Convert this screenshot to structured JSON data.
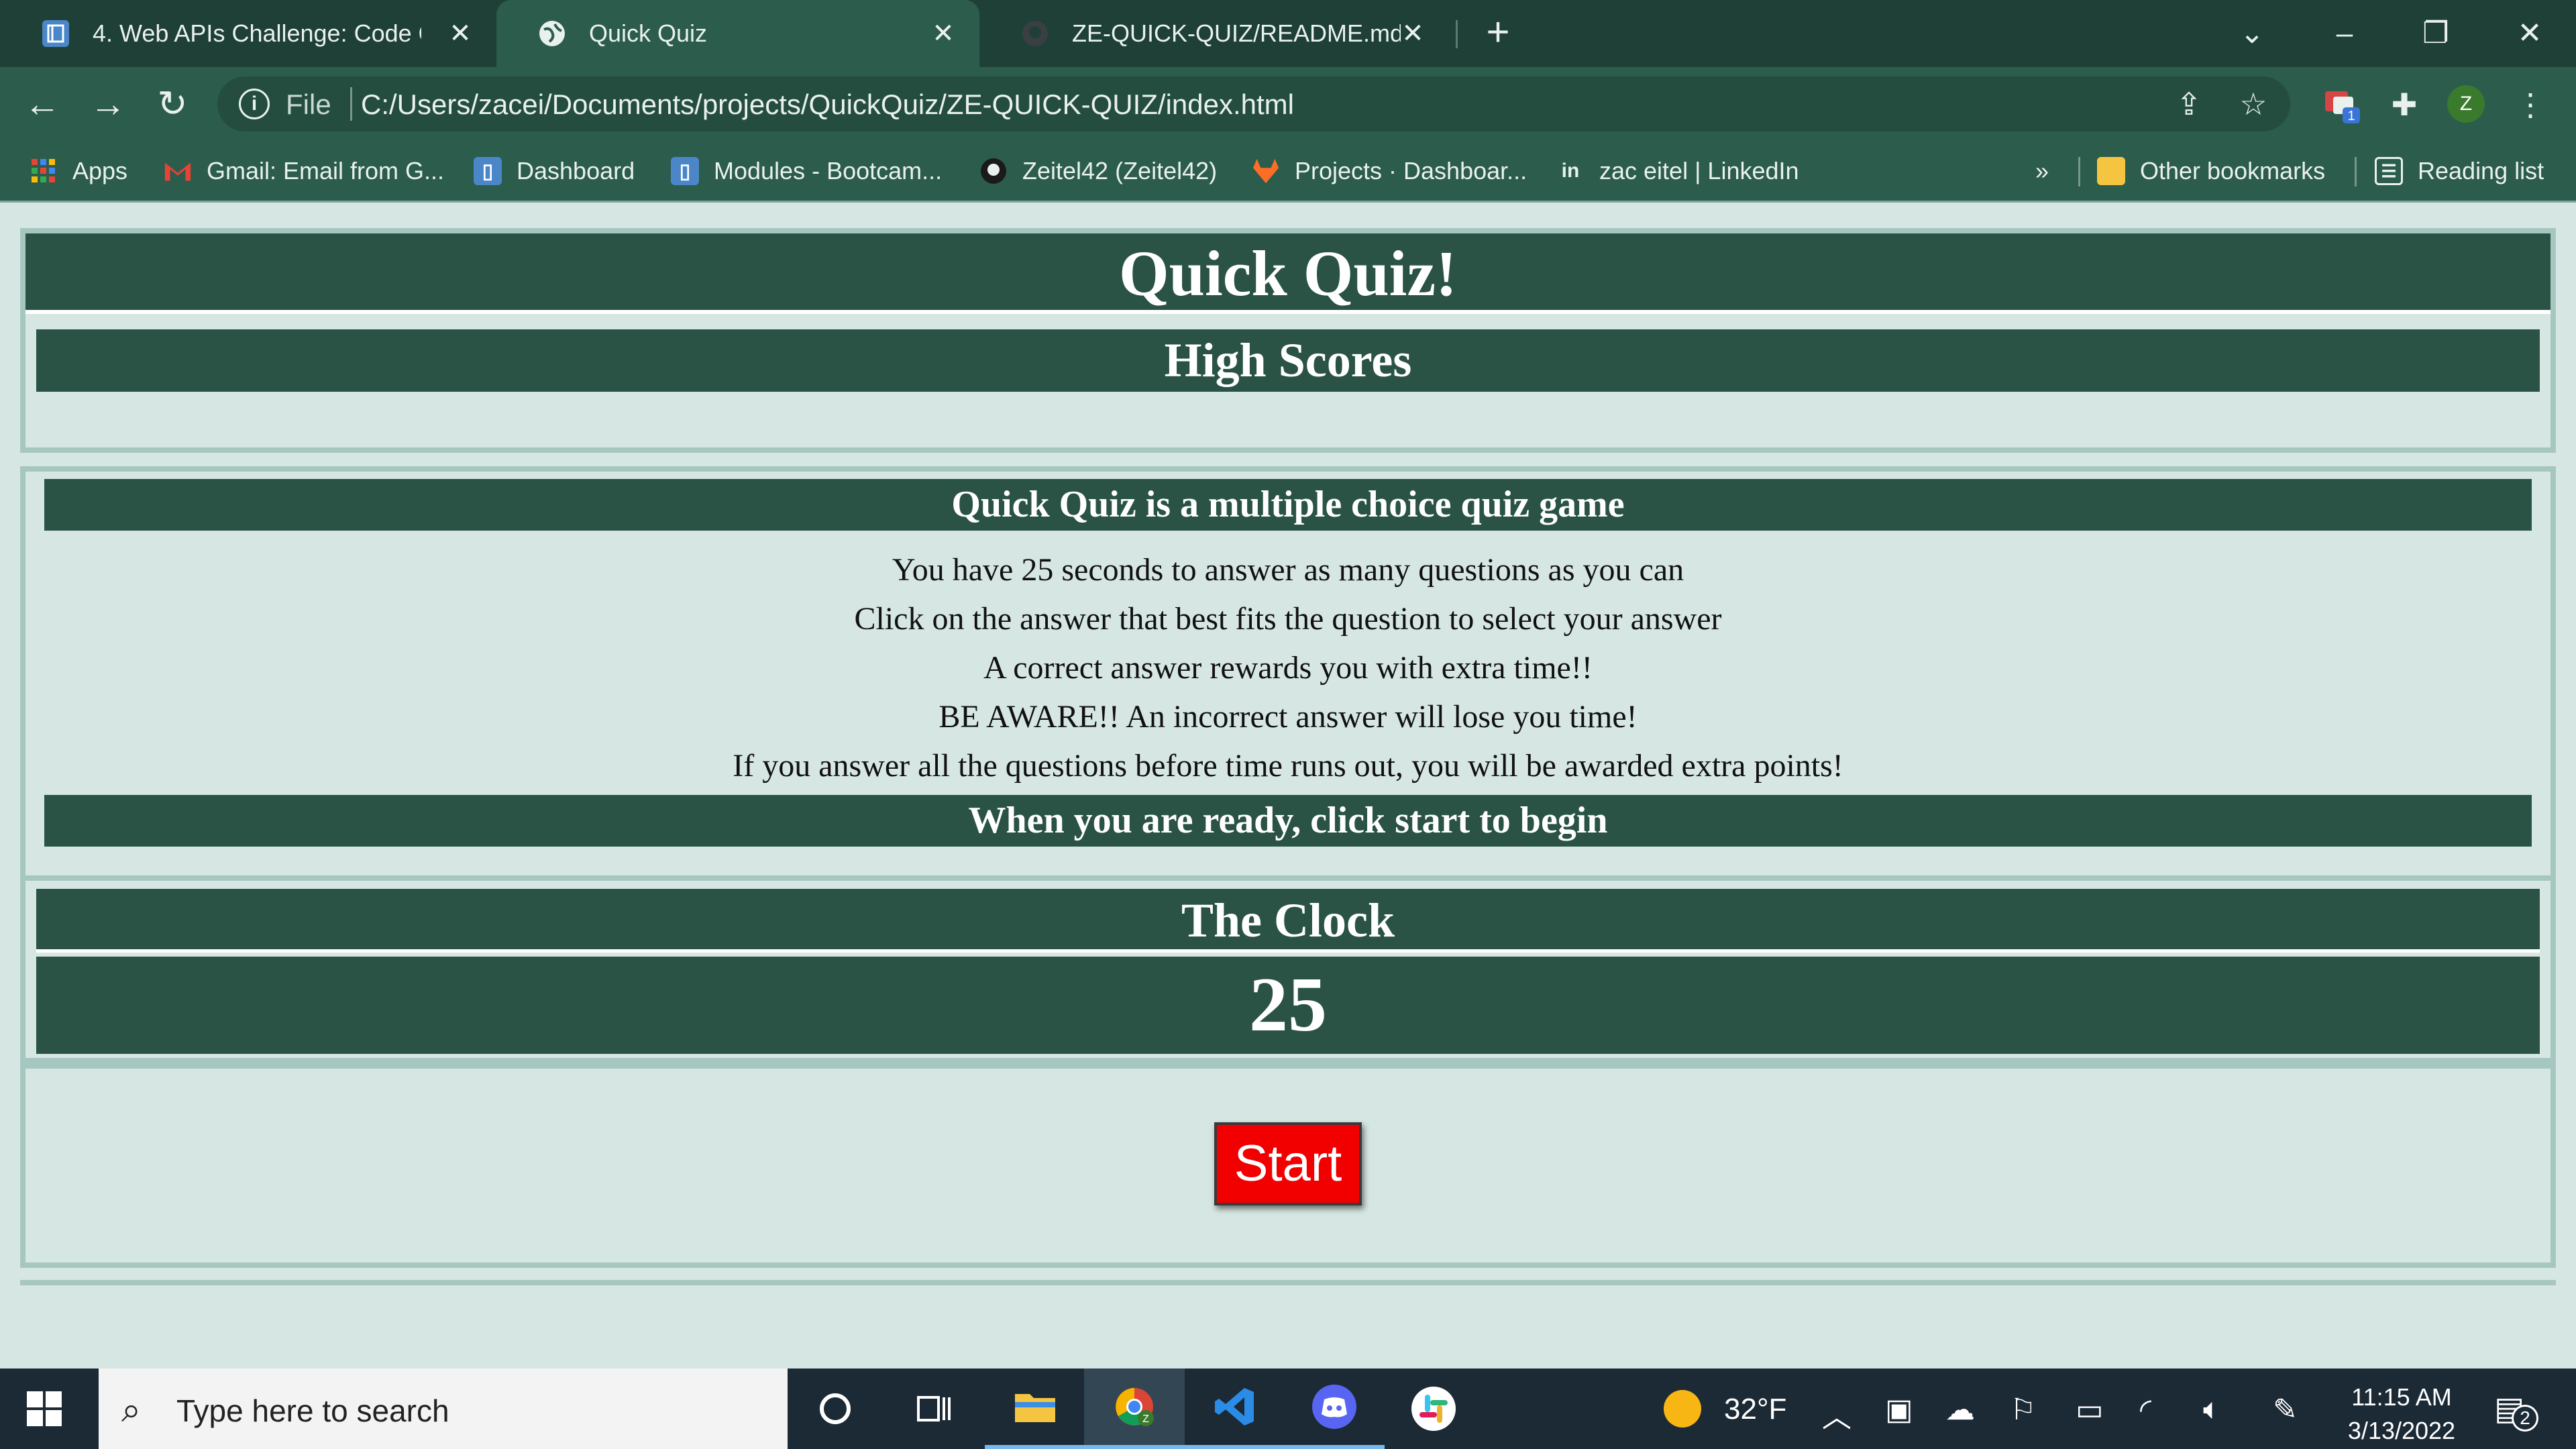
{
  "browser": {
    "tabs": [
      {
        "title": "4. Web APIs Challenge: Code Qui",
        "icon": "bootcamp-icon"
      },
      {
        "title": "Quick Quiz",
        "icon": "globe-icon"
      },
      {
        "title": "ZE-QUICK-QUIZ/README.md at",
        "icon": "github-icon"
      }
    ],
    "address": {
      "scheme_label": "File",
      "url": "C:/Users/zacei/Documents/projects/QuickQuiz/ZE-QUICK-QUIZ/index.html"
    },
    "extension_badge": "1",
    "profile_initial": "Z",
    "bookmarks": [
      {
        "label": "Apps",
        "icon": "apps-grid-icon"
      },
      {
        "label": "Gmail: Email from G...",
        "icon": "gmail-icon"
      },
      {
        "label": "Dashboard",
        "icon": "bootcamp-icon"
      },
      {
        "label": "Modules - Bootcam...",
        "icon": "bootcamp-icon"
      },
      {
        "label": "Zeitel42 (Zeitel42)",
        "icon": "github-icon"
      },
      {
        "label": "Projects · Dashboar...",
        "icon": "gitlab-icon"
      },
      {
        "label": "zac eitel | LinkedIn",
        "icon": "linkedin-icon"
      }
    ],
    "overflow_label": "»",
    "other_bookmarks": "Other bookmarks",
    "reading_list": "Reading list"
  },
  "page": {
    "title": "Quick Quiz!",
    "high_scores": "High Scores",
    "info_title": "Quick Quiz is a multiple choice quiz game",
    "info_lines": [
      "You have 25 seconds to answer as many questions as you can",
      "Click on the answer that best fits the question to select your answer",
      "A correct answer rewards you with extra time!!",
      "BE AWARE!! An incorrect answer will lose you time!",
      "If you answer all the questions before time runs out, you will be awarded extra points!"
    ],
    "info_footer": "When you are ready, click start to begin",
    "clock_title": "The Clock",
    "clock_value": "25",
    "start_label": "Start"
  },
  "taskbar": {
    "search_placeholder": "Type here to search",
    "weather": "32°F",
    "time": "11:15 AM",
    "date": "3/13/2022",
    "notifications": "2"
  },
  "colors": {
    "chrome_dark": "#1f4036",
    "chrome": "#2c5c4c",
    "panel_bar": "#2a5346",
    "page_bg": "#d6e6e2",
    "start_button": "#f20000"
  }
}
